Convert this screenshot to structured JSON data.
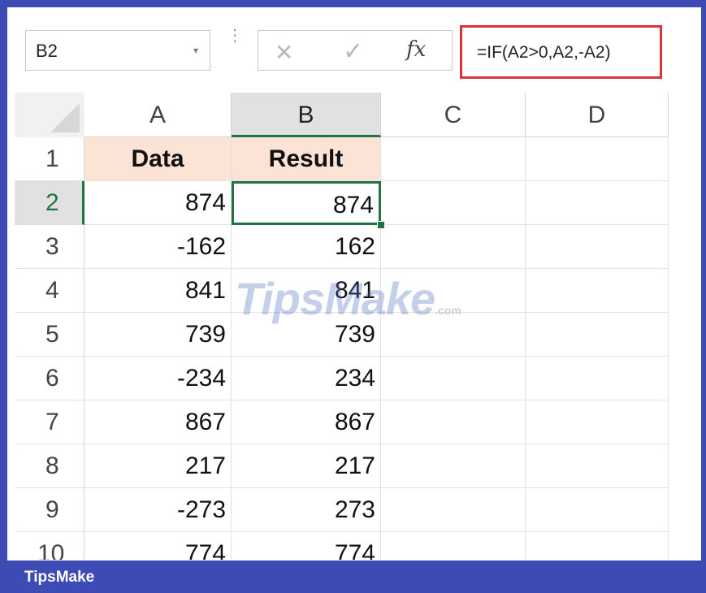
{
  "formula_bar": {
    "name_box": "B2",
    "name_box_arrow": "▾",
    "dots": "⋮",
    "cancel_icon": "✕",
    "enter_icon": "✓",
    "fx_label": "fx",
    "formula": "=IF(A2>0,A2,-A2)"
  },
  "columns": [
    "A",
    "B",
    "C",
    "D"
  ],
  "active_column": "B",
  "rows": [
    {
      "num": "1",
      "a": "Data",
      "b": "Result"
    },
    {
      "num": "2",
      "a": "874",
      "b": "874"
    },
    {
      "num": "3",
      "a": "-162",
      "b": "162"
    },
    {
      "num": "4",
      "a": "841",
      "b": "841"
    },
    {
      "num": "5",
      "a": "739",
      "b": "739"
    },
    {
      "num": "6",
      "a": "-234",
      "b": "234"
    },
    {
      "num": "7",
      "a": "867",
      "b": "867"
    },
    {
      "num": "8",
      "a": "217",
      "b": "217"
    },
    {
      "num": "9",
      "a": "-273",
      "b": "273"
    },
    {
      "num": "10",
      "a": "774",
      "b": "774"
    }
  ],
  "active_row": "2",
  "watermark": {
    "main": "TipsMake",
    "suffix": ".com"
  },
  "footer": {
    "brand": "TipsMake"
  },
  "colors": {
    "frame": "#3f4bb4",
    "header_fill": "#fbe4d6",
    "selection": "#217346",
    "formula_highlight": "#d8343c"
  }
}
